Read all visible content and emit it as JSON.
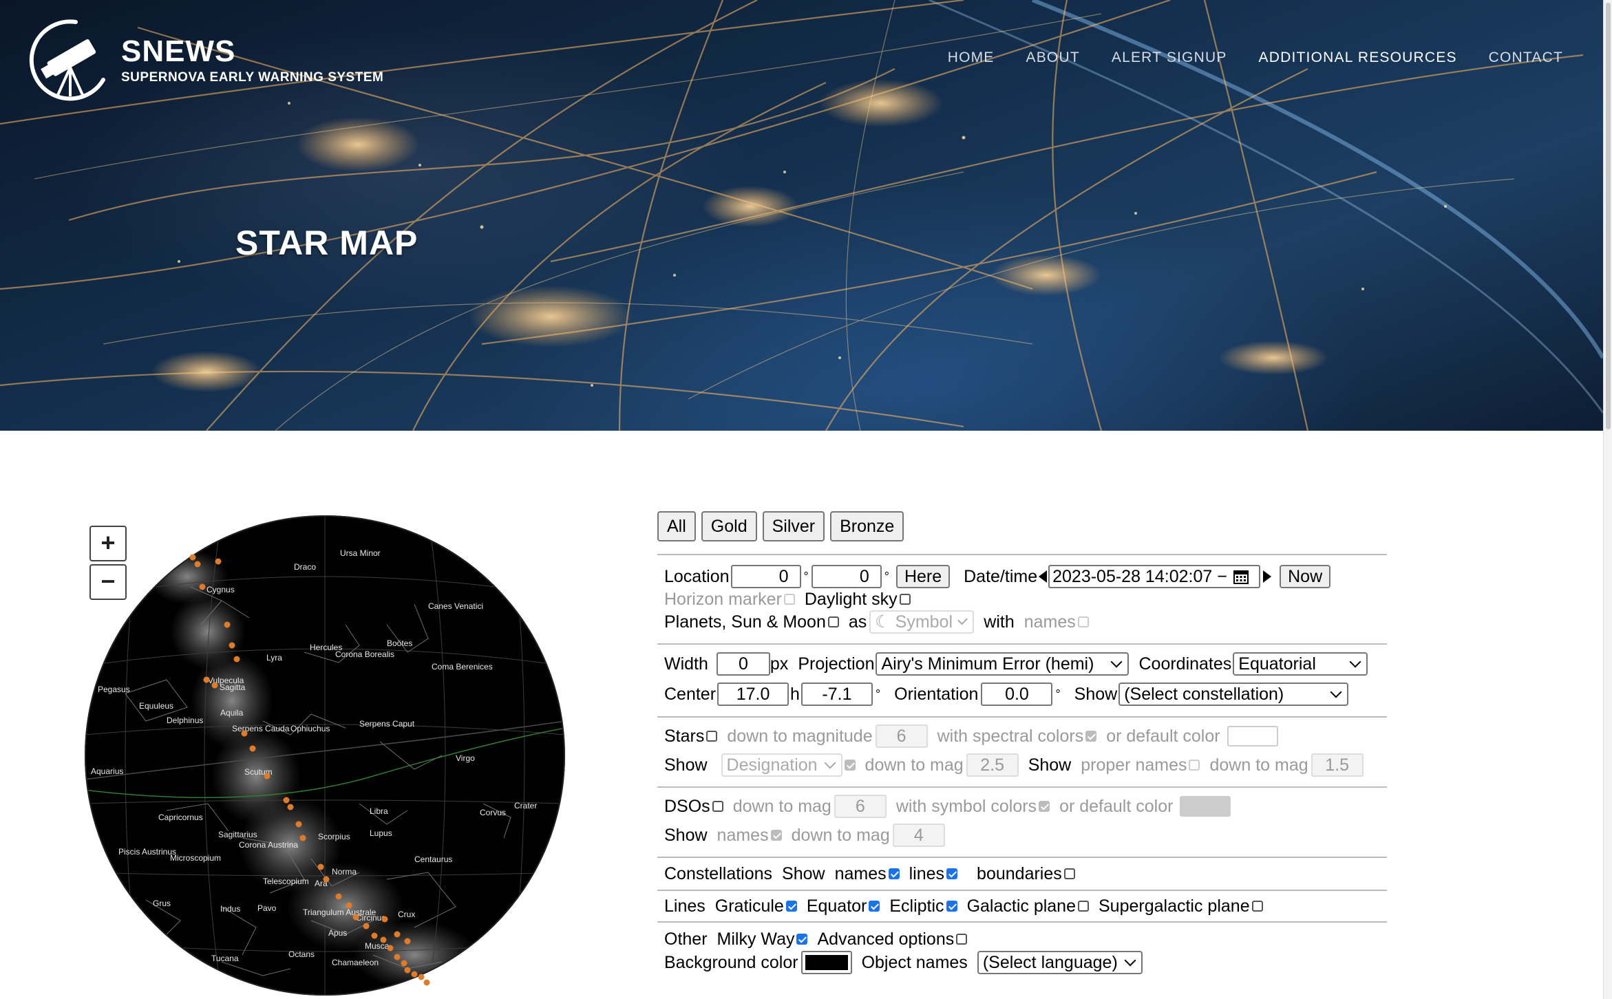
{
  "brand": {
    "title": "SNEWS",
    "subtitle": "SUPERNOVA EARLY WARNING SYSTEM"
  },
  "nav": [
    {
      "label": "HOME"
    },
    {
      "label": "ABOUT"
    },
    {
      "label": "ALERT SIGNUP"
    },
    {
      "label": "ADDITIONAL RESOURCES"
    },
    {
      "label": "CONTACT"
    }
  ],
  "hero": {
    "title": "STAR MAP"
  },
  "map": {
    "zoom_in": "+",
    "zoom_out": "−",
    "constellation_labels": [
      "Ursa Minor",
      "Draco",
      "Cygnus",
      "Canes Venatici",
      "Lyra",
      "Hercules",
      "Corona Borealis",
      "Boötes",
      "Coma Berenices",
      "Pegasus",
      "Vulpecula",
      "Sagitta",
      "Equuleus",
      "Aquila",
      "Delphinus",
      "Serpens Cauda",
      "Ophiuchus",
      "Serpens Caput",
      "Virgo",
      "Aquarius",
      "Scutum",
      "Libra",
      "Crater",
      "Corvus",
      "Capricornus",
      "Sagittarius",
      "Scorpius",
      "Lupus",
      "Piscis Austrinus",
      "Corona Austrina",
      "Microscopium",
      "Centaurus",
      "Norma",
      "Telescopium",
      "Ara",
      "Grus",
      "Indus",
      "Pavo",
      "Triangulum Australe",
      "Circinus",
      "Crux",
      "Apus",
      "Musca",
      "Tucana",
      "Octans",
      "Chamaeleon"
    ]
  },
  "presets": [
    "All",
    "Gold",
    "Silver",
    "Bronze"
  ],
  "location": {
    "label": "Location",
    "lat": "0",
    "lon": "0",
    "deg": "°",
    "here": "Here",
    "datetime_label": "Date/time",
    "datetime": "2023-05-28 14:02:07 −",
    "now": "Now",
    "horizon": "Horizon marker",
    "daylight": "Daylight sky",
    "planets": "Planets, Sun & Moon",
    "as": "as",
    "symbol": "☾ Symbol",
    "with": "with",
    "names": "names"
  },
  "view": {
    "width_label": "Width",
    "width": "0",
    "px": "px",
    "projection_label": "Projection",
    "projection": "Airy's Minimum Error (hemi)",
    "coords_label": "Coordinates",
    "coords": "Equatorial",
    "center_label": "Center",
    "ra": "17.0",
    "h": "h",
    "dec": "-7.1",
    "deg": "°",
    "orientation_label": "Orientation",
    "orientation": "0.0",
    "show_label": "Show",
    "constellation": "(Select constellation)"
  },
  "stars": {
    "label": "Stars",
    "down_to_mag": "down to magnitude",
    "mag": "6",
    "spectral": "with spectral colors",
    "default_color": "or default color",
    "show": "Show",
    "designation": "Designation",
    "down_to_mag2": "down to mag",
    "mag2": "2.5",
    "show2": "Show",
    "proper": "proper names",
    "down_to_mag3": "down to mag",
    "mag3": "1.5"
  },
  "dsos": {
    "label": "DSOs",
    "down_to_mag": "down to mag",
    "mag": "6",
    "symbol_colors": "with symbol colors",
    "default_color": "or default color",
    "show": "Show",
    "names": "names",
    "down_to_mag2": "down to mag",
    "mag2": "4"
  },
  "constellations": {
    "label": "Constellations",
    "show": "Show",
    "names": "names",
    "lines": "lines",
    "boundaries": "boundaries"
  },
  "lines": {
    "label": "Lines",
    "graticule": "Graticule",
    "equator": "Equator",
    "ecliptic": "Ecliptic",
    "galactic": "Galactic plane",
    "supergalactic": "Supergalactic plane"
  },
  "other": {
    "label": "Other",
    "milky": "Milky Way",
    "advanced": "Advanced options",
    "bg": "Background color",
    "object_names": "Object names",
    "language": "(Select language)"
  },
  "colors": {
    "star_default": "#ffffff",
    "dso_default": "#cccccc",
    "background": "#000000",
    "detector_marker": "#e07b2a",
    "checkbox_on": "#1a73e8"
  }
}
